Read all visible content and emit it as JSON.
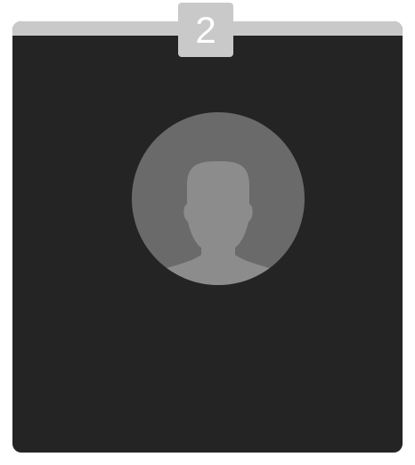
{
  "participant_tile": {
    "count_badge": "2",
    "avatar_icon": "person-silhouette-icon",
    "colors": {
      "tile_background": "#242424",
      "top_bar": "#c9c9c9",
      "badge_background": "#c9c9c9",
      "badge_text": "#ffffff",
      "avatar_circle": "#6a6a6a",
      "avatar_figure": "#8c8c8c"
    }
  }
}
